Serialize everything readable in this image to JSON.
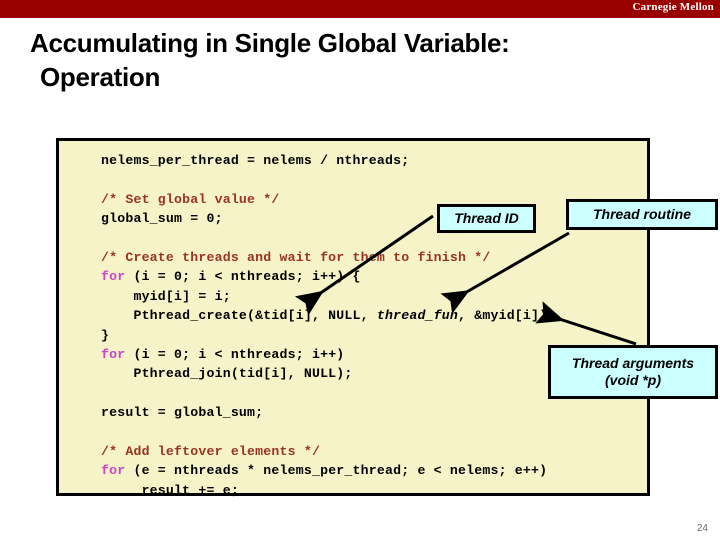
{
  "banner": {
    "brand": "Carnegie Mellon",
    "color": "#990000"
  },
  "slide": {
    "title_line1": "Accumulating in Single Global Variable:",
    "title_line2": "Operation",
    "page_number": "24"
  },
  "code_block": {
    "background": "#f7f3c8",
    "comment_color": "#993322",
    "keyword_color": "#cc44cc",
    "lines": [
      "nelems_per_thread = nelems / nthreads;",
      "",
      "/* Set global value */",
      "global_sum = 0;",
      "",
      "/* Create threads and wait for them to finish */",
      "for (i = 0; i < nthreads; i++) {",
      "    myid[i] = i;",
      "    Pthread_create(&tid[i], NULL, thread_fun, &myid[i]);",
      "}",
      "for (i = 0; i < nthreads; i++)",
      "    Pthread_join(tid[i], NULL);",
      "",
      "result = global_sum;",
      "",
      "/* Add leftover elements */",
      "for (e = nthreads * nelems_per_thread; e < nelems; e++)",
      "     result += e;"
    ]
  },
  "callouts": {
    "background": "#ccffff",
    "thread_id": "Thread ID",
    "thread_routine": "Thread routine",
    "thread_args_line1": "Thread arguments",
    "thread_args_line2": "(void *p)"
  }
}
